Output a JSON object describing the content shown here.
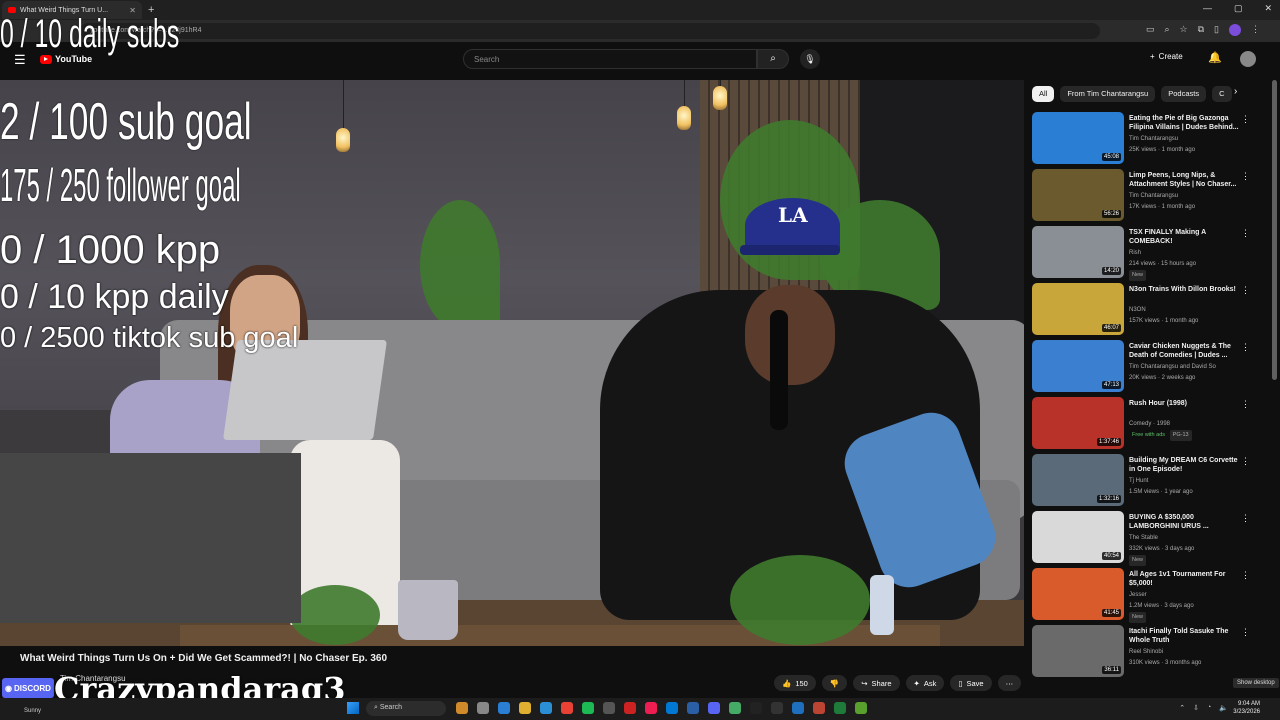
{
  "browser": {
    "tab_title": "What Weird Things Turn U...",
    "url": "youtube.com/watch?v=...h28j91hR4"
  },
  "youtube": {
    "logo": "YouTube",
    "search_placeholder": "Search",
    "create_label": "Create"
  },
  "overlay": {
    "daily_subs": "0 / 10 daily subs",
    "sub_goal": "2  / 100 sub goal",
    "follower_goal": "175 / 250 follower goal",
    "kpp": "0 / 1000 kpp",
    "kpp_daily": "0 / 10 kpp daily",
    "tiktok_goal": "0 / 2500 tiktok sub goal"
  },
  "video": {
    "title": "What Weird Things Turn Us On + Did We Get Scammed?! | No Chaser Ep. 360",
    "channel": "Tim Chantarangsu",
    "likes": "150",
    "share_label": "Share",
    "ask_label": "Ask",
    "save_label": "Save"
  },
  "chips": [
    "All",
    "From Tim Chantarangsu",
    "Podcasts",
    "C"
  ],
  "recommendations": [
    {
      "title": "Eating the Pie of Big Gazonga Filipina Villains | Dudes Behind...",
      "channel": "Tim Chantarangsu",
      "meta": "25K views · 1 month ago",
      "duration": "45:08",
      "badge": "",
      "color": "#2a7fd4"
    },
    {
      "title": "Limp Peens, Long Nips, & Attachment Styles | No Chaser...",
      "channel": "Tim Chantarangsu",
      "meta": "17K views · 1 month ago",
      "duration": "56:26",
      "badge": "",
      "color": "#6b5a2e"
    },
    {
      "title": "TSX FINALLY Making A COMEBACK!",
      "channel": "Rish",
      "meta": "214 views · 15 hours ago",
      "duration": "14:20",
      "badge": "New",
      "color": "#8a8f96"
    },
    {
      "title": "N3on Trains With Dillon Brooks!",
      "channel": "N3ON",
      "meta": "157K views · 1 month ago",
      "duration": "46:07",
      "badge": "",
      "color": "#c9a63a"
    },
    {
      "title": "Caviar Chicken Nuggets & The Death of Comedies | Dudes ...",
      "channel": "Tim Chantarangsu and David So",
      "meta": "20K views · 2 weeks ago",
      "duration": "47:13",
      "badge": "",
      "color": "#3a7fd0"
    },
    {
      "title": "Rush Hour (1998)",
      "channel": "Comedy · 1998",
      "meta": "",
      "duration": "1:37:46",
      "badge": "Free with ads",
      "badge2": "PG-13",
      "color": "#b8322a"
    },
    {
      "title": "Building My DREAM C6 Corvette in One Episode!",
      "channel": "Tj Hunt",
      "meta": "1.5M views · 1 year ago",
      "duration": "1:32:16",
      "badge": "",
      "color": "#5a6a78"
    },
    {
      "title": "BUYING A $350,000 LAMBORGHINI URUS ...",
      "channel": "The Stable",
      "meta": "332K views · 3 days ago",
      "duration": "40:54",
      "badge": "New",
      "color": "#d9d9d9"
    },
    {
      "title": "All Ages 1v1 Tournament For $5,000!",
      "channel": "Jesser",
      "meta": "1.2M views · 3 days ago",
      "duration": "41:45",
      "badge": "New",
      "color": "#d95a2a"
    },
    {
      "title": "Itachi Finally Told Sasuke The Whole Truth",
      "channel": "Reel Shinobi",
      "meta": "310K views · 3 months ago",
      "duration": "36:11",
      "badge": "",
      "color": "#6a6a6a"
    }
  ],
  "discord": {
    "badge": "DISCORD",
    "username": "Crazypandarag3"
  },
  "taskbar": {
    "weather": "Sunny",
    "search": "Search",
    "time": "9:04 AM",
    "date": "3/23/2026",
    "show_desktop": "Show desktop"
  }
}
